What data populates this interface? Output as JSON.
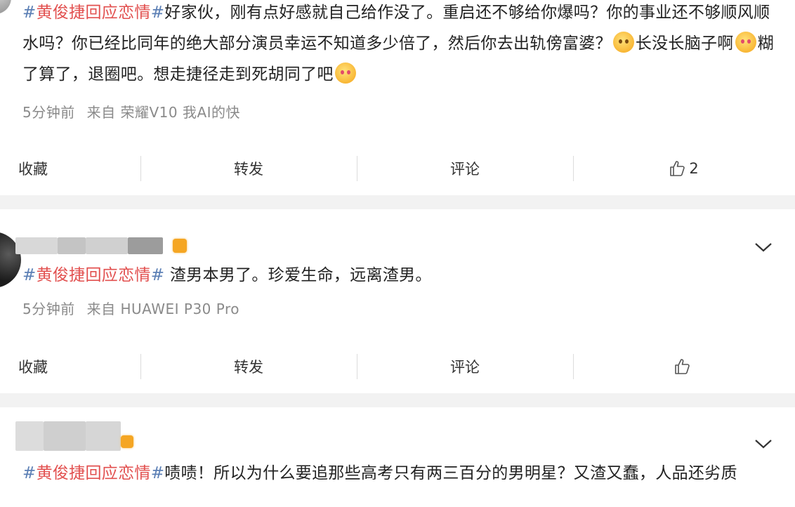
{
  "posts": [
    {
      "hashtag": "黄俊捷回应恋情",
      "text_a": "好家伙，刚有点好感就自己给作没了。重启还不够给你爆吗？你的事业还不够顺风顺水吗？你已经比同年的绝大部分演员幸运不知道多少倍了，然后你去出轨傍富婆？",
      "text_b": "长没长脑子啊",
      "text_c": "糊了算了，退圈吧。想走捷径走到死胡同了吧",
      "time": "5分钟前",
      "source": "来自 荣耀V10 我AI的快",
      "actions": {
        "favorite": "收藏",
        "repost": "转发",
        "comment": "评论",
        "like_count": "2"
      }
    },
    {
      "hashtag": "黄俊捷回应恋情",
      "text_a": " 渣男本男了。珍爱生命，远离渣男。",
      "time": "5分钟前",
      "source": "来自 HUAWEI P30 Pro",
      "actions": {
        "favorite": "收藏",
        "repost": "转发",
        "comment": "评论",
        "like_count": ""
      }
    },
    {
      "hashtag": "黄俊捷回应恋情",
      "text_a": "啧啧！所以为什么要追那些高考只有两三百分的男明星？又渣又蠢，人品还劣质"
    }
  ],
  "hash_symbol": "#",
  "colors": {
    "hashtag_text": "#e2504f",
    "hash_symbol": "#5b7fb5",
    "meta_text": "#8a8a8a",
    "divider": "#f2f2f2",
    "vip_badge": "#f5a623"
  },
  "icons": {
    "emoji_sweat": "emoji-sweat-icon",
    "emoji_blush": "emoji-blush-icon",
    "chevron": "chevron-down-icon",
    "like": "thumbs-up-icon"
  }
}
